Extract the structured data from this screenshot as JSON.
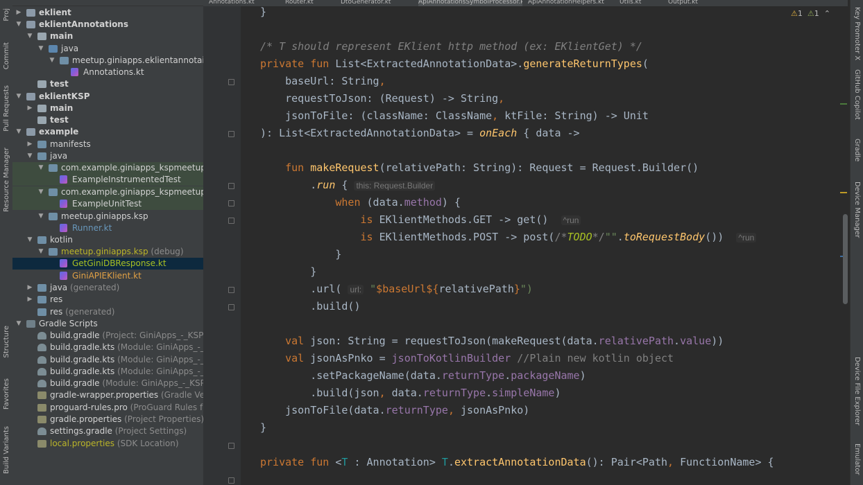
{
  "left_strip": {
    "tabs": [
      "Proj",
      "Commit",
      "Pull Requests",
      "Resource Manager",
      "Structure",
      "Favorites",
      "Build Variants"
    ]
  },
  "right_strip": {
    "tabs": [
      "Key Promoter X",
      "GitHub Copilot",
      "Gradle",
      "Device Manager",
      "Device File Explorer",
      "Emulator"
    ]
  },
  "editor_tabs": [
    "Annotations.kt",
    "Router.kt",
    "DtoGenerator.kt",
    "ApiAnnotationsSymbolProcessor.kt",
    "ApiAnnotationHelpers.kt",
    "Utils.kt",
    "Output.kt"
  ],
  "inspection": {
    "warnings": "1",
    "weak_warnings": "1"
  },
  "project_tree": [
    {
      "label": "eklient",
      "depth": 1,
      "arrow": "right",
      "icon": "folder-mod",
      "bold": true
    },
    {
      "label": "eklientAnnotations",
      "depth": 1,
      "arrow": "down",
      "icon": "folder-mod",
      "bold": true
    },
    {
      "label": "main",
      "depth": 2,
      "arrow": "down",
      "icon": "folder-plain",
      "bold": true
    },
    {
      "label": "java",
      "depth": 3,
      "arrow": "down",
      "icon": "folder-src"
    },
    {
      "label": "meetup.giniapps.eklientannotaions",
      "depth": 4,
      "arrow": "down",
      "icon": "folder"
    },
    {
      "label": "Annotations.kt",
      "depth": 5,
      "arrow": "",
      "icon": "kt"
    },
    {
      "label": "test",
      "depth": 2,
      "arrow": "",
      "icon": "folder-plain",
      "bold": true
    },
    {
      "label": "eklientKSP",
      "depth": 1,
      "arrow": "down",
      "icon": "folder-mod",
      "bold": true
    },
    {
      "label": "main",
      "depth": 2,
      "arrow": "right",
      "icon": "folder-plain",
      "bold": true
    },
    {
      "label": "test",
      "depth": 2,
      "arrow": "",
      "icon": "folder-plain",
      "bold": true
    },
    {
      "label": "example",
      "depth": 1,
      "arrow": "down",
      "icon": "folder-mod",
      "bold": true
    },
    {
      "label": "manifests",
      "depth": 2,
      "arrow": "right",
      "icon": "folder"
    },
    {
      "label": "java",
      "depth": 2,
      "arrow": "down",
      "icon": "folder"
    },
    {
      "label": "com.example.giniapps_kspmeetup",
      "hint": "(an",
      "depth": 3,
      "arrow": "down",
      "icon": "folder",
      "hl": true
    },
    {
      "label": "ExampleInstrumentedTest",
      "depth": 4,
      "arrow": "",
      "icon": "kt",
      "hl": true
    },
    {
      "label": "com.example.giniapps_kspmeetup",
      "hint": "(te:",
      "depth": 3,
      "arrow": "down",
      "icon": "folder",
      "hl": true
    },
    {
      "label": "ExampleUnitTest",
      "depth": 4,
      "arrow": "",
      "icon": "kt",
      "hl": true
    },
    {
      "label": "meetup.giniapps.ksp",
      "depth": 3,
      "arrow": "down",
      "icon": "folder"
    },
    {
      "label": "Runner.kt",
      "depth": 4,
      "arrow": "",
      "icon": "kt",
      "color": "blue"
    },
    {
      "label": "kotlin",
      "depth": 2,
      "arrow": "down",
      "icon": "folder"
    },
    {
      "label": "meetup.giniapps.ksp",
      "hint": "(debug)",
      "depth": 3,
      "arrow": "down",
      "icon": "folder",
      "color": "yellow"
    },
    {
      "label": "GetGiniDBResponse.kt",
      "depth": 4,
      "arrow": "",
      "icon": "kt",
      "color": "olive",
      "sel": true
    },
    {
      "label": "GiniAPIEKlient.kt",
      "depth": 4,
      "arrow": "",
      "icon": "kt",
      "color": "orange"
    },
    {
      "label": "java",
      "hint": "(generated)",
      "depth": 2,
      "arrow": "right",
      "icon": "folder"
    },
    {
      "label": "res",
      "depth": 2,
      "arrow": "right",
      "icon": "folder"
    },
    {
      "label": "res",
      "hint": "(generated)",
      "depth": 2,
      "arrow": "",
      "icon": "folder"
    },
    {
      "label": "Gradle Scripts",
      "depth": 1,
      "arrow": "down",
      "icon": "gs"
    },
    {
      "label": "build.gradle",
      "hint": "(Project: GiniApps_-_KSP_Me",
      "depth": 2,
      "arrow": "",
      "icon": "gradle"
    },
    {
      "label": "build.gradle.kts",
      "hint": "(Module: GiniApps_-_KSP",
      "depth": 2,
      "arrow": "",
      "icon": "gradle"
    },
    {
      "label": "build.gradle.kts",
      "hint": "(Module: GiniApps_-_KSP",
      "depth": 2,
      "arrow": "",
      "icon": "gradle"
    },
    {
      "label": "build.gradle.kts",
      "hint": "(Module: GiniApps_-_KSP",
      "depth": 2,
      "arrow": "",
      "icon": "gradle"
    },
    {
      "label": "build.gradle",
      "hint": "(Module: GiniApps_-_KSP_M",
      "depth": 2,
      "arrow": "",
      "icon": "gradle"
    },
    {
      "label": "gradle-wrapper.properties",
      "hint": "(Gradle Versio",
      "depth": 2,
      "arrow": "",
      "icon": "props"
    },
    {
      "label": "proguard-rules.pro",
      "hint": "(ProGuard Rules for G",
      "depth": 2,
      "arrow": "",
      "icon": "props"
    },
    {
      "label": "gradle.properties",
      "hint": "(Project Properties)",
      "depth": 2,
      "arrow": "",
      "icon": "props"
    },
    {
      "label": "settings.gradle",
      "hint": "(Project Settings)",
      "depth": 2,
      "arrow": "",
      "icon": "gradle"
    },
    {
      "label": "local.properties",
      "hint": "(SDK Location)",
      "depth": 2,
      "arrow": "",
      "icon": "props",
      "color": "yellow"
    }
  ],
  "code_lines": [
    [
      {
        "t": "}"
      }
    ],
    [],
    [
      {
        "t": "/* T should represent EKlient http method (ex: EKlientGet) */",
        "c": "cm it"
      }
    ],
    [
      {
        "t": "private fun ",
        "c": "kw"
      },
      {
        "t": "List<ExtractedAnnotationData>."
      },
      {
        "t": "generateReturnTypes",
        "c": "fn"
      },
      {
        "t": "("
      }
    ],
    [
      {
        "t": "    baseUrl: String"
      },
      {
        "t": ",",
        "c": "kw"
      }
    ],
    [
      {
        "t": "    requestToJson: (Request) -> String"
      },
      {
        "t": ",",
        "c": "kw"
      }
    ],
    [
      {
        "t": "    jsonToFile: (className: ClassName"
      },
      {
        "t": ",",
        "c": "kw"
      },
      {
        "t": " ktFile: String) -> Unit"
      }
    ],
    [
      {
        "t": "): List<ExtractedAnnotationData> = "
      },
      {
        "t": "onEach",
        "c": "ext"
      },
      {
        "t": " { data ->"
      }
    ],
    [],
    [
      {
        "t": "    fun ",
        "c": "kw"
      },
      {
        "t": "makeRequest",
        "c": "fn"
      },
      {
        "t": "(relativePath: String): Request = Request.Builder()"
      }
    ],
    [
      {
        "t": "        ."
      },
      {
        "t": "run",
        "c": "ext"
      },
      {
        "t": " { "
      },
      {
        "t": "this: Request.Builder",
        "c": "hint"
      }
    ],
    [
      {
        "t": "            when ",
        "c": "kw"
      },
      {
        "t": "(data."
      },
      {
        "t": "method",
        "c": "prop"
      },
      {
        "t": ") {"
      }
    ],
    [
      {
        "t": "                is ",
        "c": "kw"
      },
      {
        "t": "EKlientMethods.GET -> get()  "
      },
      {
        "t": "^run",
        "c": "hint"
      }
    ],
    [
      {
        "t": "                is ",
        "c": "kw"
      },
      {
        "t": "EKlientMethods.POST -> post("
      },
      {
        "t": "/*",
        "c": "cm"
      },
      {
        "t": "TODO",
        "c": "todo"
      },
      {
        "t": "*/",
        "c": "cm"
      },
      {
        "t": "\"\"",
        "c": "str"
      },
      {
        "t": "."
      },
      {
        "t": "toRequestBody",
        "c": "ext"
      },
      {
        "t": "())  "
      },
      {
        "t": "^run",
        "c": "hint"
      }
    ],
    [
      {
        "t": "            }"
      }
    ],
    [
      {
        "t": "        }"
      }
    ],
    [
      {
        "t": "        .url( "
      },
      {
        "t": "url:",
        "c": "hint"
      },
      {
        "t": " "
      },
      {
        "t": "\"",
        "c": "str"
      },
      {
        "t": "$baseUrl",
        "c": "kw"
      },
      {
        "t": "${",
        "c": "kw"
      },
      {
        "t": "relativePath"
      },
      {
        "t": "}",
        "c": "kw"
      },
      {
        "t": "\")",
        "c": "str"
      }
    ],
    [
      {
        "t": "        .build()"
      }
    ],
    [],
    [
      {
        "t": "    val ",
        "c": "kw"
      },
      {
        "t": "json: String = requestToJson(makeRequest(data."
      },
      {
        "t": "relativePath",
        "c": "prop"
      },
      {
        "t": "."
      },
      {
        "t": "value",
        "c": "prop"
      },
      {
        "t": "))"
      }
    ],
    [
      {
        "t": "    val ",
        "c": "kw"
      },
      {
        "t": "jsonAsPnko = "
      },
      {
        "t": "jsonToKotlinBuilder",
        "c": "prop"
      },
      {
        "t": " "
      },
      {
        "t": "//Plain new kotlin object",
        "c": "cm"
      }
    ],
    [
      {
        "t": "        .setPackageName(data."
      },
      {
        "t": "returnType",
        "c": "prop"
      },
      {
        "t": "."
      },
      {
        "t": "packageName",
        "c": "prop"
      },
      {
        "t": ")"
      }
    ],
    [
      {
        "t": "        .build(json"
      },
      {
        "t": ",",
        "c": "kw"
      },
      {
        "t": " data."
      },
      {
        "t": "returnType",
        "c": "prop"
      },
      {
        "t": "."
      },
      {
        "t": "simpleName",
        "c": "prop"
      },
      {
        "t": ")"
      }
    ],
    [
      {
        "t": "    jsonToFile(data."
      },
      {
        "t": "returnType",
        "c": "prop"
      },
      {
        "t": ",",
        "c": "kw"
      },
      {
        "t": " jsonAsPnko)"
      }
    ],
    [
      {
        "t": "}"
      }
    ],
    [],
    [
      {
        "t": "private fun ",
        "c": "kw"
      },
      {
        "t": "<"
      },
      {
        "t": "T",
        "c": "tp"
      },
      {
        "t": " : Annotation> "
      },
      {
        "t": "T",
        "c": "tp"
      },
      {
        "t": "."
      },
      {
        "t": "extractAnnotationData",
        "c": "fn"
      },
      {
        "t": "(): Pair<Path"
      },
      {
        "t": ",",
        "c": "kw"
      },
      {
        "t": " FunctionName> {"
      }
    ]
  ]
}
